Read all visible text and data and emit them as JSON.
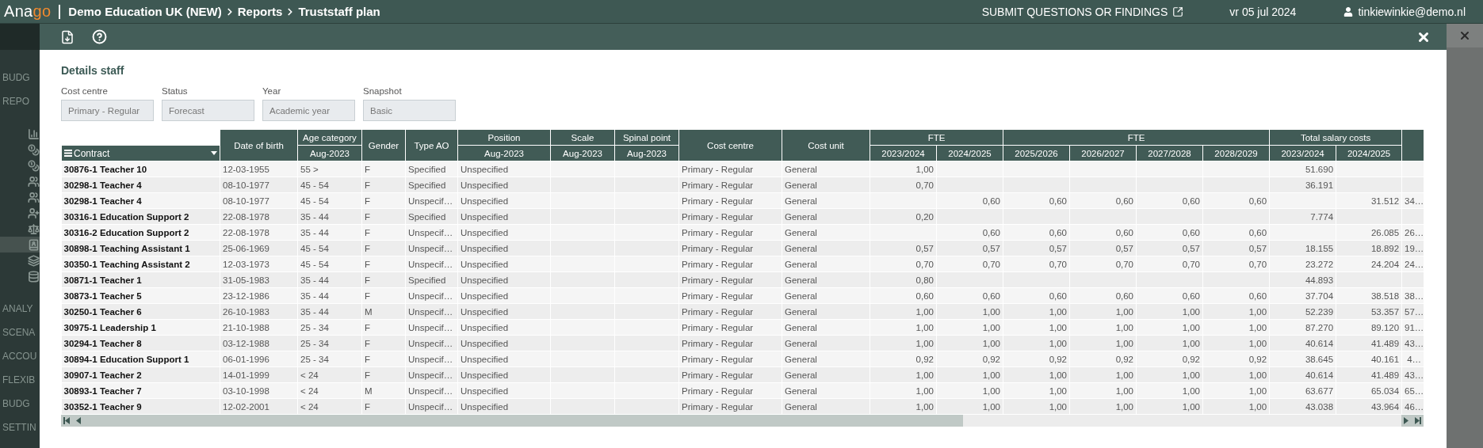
{
  "top_bar": {
    "logo": {
      "text": "Ana",
      "accent": "go"
    },
    "breadcrumb": [
      "Demo Education UK (NEW)",
      "Reports",
      "Truststaff plan"
    ],
    "feedback_link": "SUBMIT QUESTIONS OR FINDINGS",
    "date": "vr 05 jul 2024",
    "user": "tinkiewinkie@demo.nl"
  },
  "sidebar": {
    "items": [
      {
        "kind": "text",
        "label": "BUDG"
      },
      {
        "kind": "text",
        "label": "REPO"
      },
      {
        "kind": "icon",
        "selected": false
      },
      {
        "kind": "icon",
        "selected": false
      },
      {
        "kind": "icon",
        "selected": false
      },
      {
        "kind": "icon",
        "selected": false
      },
      {
        "kind": "icon",
        "selected": false
      },
      {
        "kind": "icon",
        "selected": false
      },
      {
        "kind": "icon",
        "selected": false
      },
      {
        "kind": "icon",
        "selected": true
      },
      {
        "kind": "icon",
        "selected": false
      },
      {
        "kind": "icon",
        "selected": false
      },
      {
        "kind": "text",
        "label": "ANALY"
      },
      {
        "kind": "text",
        "label": "SCENA"
      },
      {
        "kind": "text",
        "label": "ACCOU"
      },
      {
        "kind": "text",
        "label": "FLEXIB"
      },
      {
        "kind": "text",
        "label": "BUDG"
      },
      {
        "kind": "text",
        "label": "SETTIN"
      }
    ]
  },
  "dialog": {
    "title": "Details staff",
    "filters": [
      {
        "label": "Cost centre",
        "value": "Primary - Regular",
        "disabled": true
      },
      {
        "label": "Status",
        "value": "Forecast",
        "disabled": true
      },
      {
        "label": "Year",
        "value": "Academic year",
        "disabled": true
      },
      {
        "label": "Snapshot",
        "value": "Basic",
        "disabled": true
      }
    ],
    "table": {
      "header": [
        {
          "kind": "menu",
          "label": "Contract"
        },
        {
          "kind": "single",
          "label": "Date of birth"
        },
        {
          "kind": "stacked",
          "label": "Age category",
          "sub": "Aug-2023"
        },
        {
          "kind": "single",
          "label": "Gender"
        },
        {
          "kind": "single",
          "label": "Type AO"
        },
        {
          "kind": "stacked",
          "label": "Position",
          "sub": "Aug-2023"
        },
        {
          "kind": "stacked",
          "label": "Scale",
          "sub": "Aug-2023"
        },
        {
          "kind": "stacked",
          "label": "Spinal point",
          "sub": "Aug-2023"
        },
        {
          "kind": "single",
          "label": "Cost centre"
        },
        {
          "kind": "single",
          "label": "Cost unit"
        },
        {
          "kind": "group",
          "label": "FTE",
          "columns": [
            "2023/2024",
            "2024/2025"
          ]
        },
        {
          "kind": "group",
          "label": "FTE",
          "columns": [
            "2025/2026",
            "2026/2027",
            "2027/2028",
            "2028/2029"
          ]
        },
        {
          "kind": "group",
          "label": "Total salary costs",
          "columns": [
            "2023/2024",
            "2024/2025"
          ]
        },
        {
          "kind": "blank"
        }
      ],
      "rows": [
        [
          "30876-1 Teacher 10",
          "12-03-1955",
          "55 >",
          "F",
          "Specified",
          "Unspecified",
          null,
          null,
          "Primary - Regular",
          "General",
          "1,00",
          null,
          null,
          null,
          null,
          null,
          "51.690",
          null,
          null
        ],
        [
          "30298-1 Teacher 4",
          "08-10-1977",
          "45 - 54",
          "F",
          "Specified",
          "Unspecified",
          null,
          null,
          "Primary - Regular",
          "General",
          "0,70",
          null,
          null,
          null,
          null,
          null,
          "36.191",
          null,
          null
        ],
        [
          "30298-1 Teacher 4",
          "08-10-1977",
          "45 - 54",
          "F",
          "Unspecif…",
          "Unspecified",
          null,
          null,
          "Primary - Regular",
          "General",
          null,
          "0,60",
          "0,60",
          "0,60",
          "0,60",
          "0,60",
          null,
          "31.512",
          "34…"
        ],
        [
          "30316-1 Education Support 2",
          "22-08-1978",
          "35 - 44",
          "F",
          "Specified",
          "Unspecified",
          null,
          null,
          "Primary - Regular",
          "General",
          "0,20",
          null,
          null,
          null,
          null,
          null,
          "7.774",
          null,
          null
        ],
        [
          "30316-2 Education Support 2",
          "22-08-1978",
          "35 - 44",
          "F",
          "Unspecif…",
          "Unspecified",
          null,
          null,
          "Primary - Regular",
          "General",
          null,
          "0,60",
          "0,60",
          "0,60",
          "0,60",
          "0,60",
          null,
          "26.085",
          "26…"
        ],
        [
          "30898-1 Teaching Assistant 1",
          "25-06-1969",
          "45 - 54",
          "F",
          "Unspecif…",
          "Unspecified",
          null,
          null,
          "Primary - Regular",
          "General",
          "0,57",
          "0,57",
          "0,57",
          "0,57",
          "0,57",
          "0,57",
          "18.155",
          "18.892",
          "19…"
        ],
        [
          "30350-1 Teaching Assistant 2",
          "12-03-1973",
          "45 - 54",
          "F",
          "Unspecif…",
          "Unspecified",
          null,
          null,
          "Primary - Regular",
          "General",
          "0,70",
          "0,70",
          "0,70",
          "0,70",
          "0,70",
          "0,70",
          "23.272",
          "24.204",
          "24…"
        ],
        [
          "30871-1 Teacher 1",
          "31-05-1983",
          "35 - 44",
          "F",
          "Specified",
          "Unspecified",
          null,
          null,
          "Primary - Regular",
          "General",
          "0,80",
          null,
          null,
          null,
          null,
          null,
          "44.893",
          null,
          null
        ],
        [
          "30873-1 Teacher 5",
          "23-12-1986",
          "35 - 44",
          "F",
          "Unspecif…",
          "Unspecified",
          null,
          null,
          "Primary - Regular",
          "General",
          "0,60",
          "0,60",
          "0,60",
          "0,60",
          "0,60",
          "0,60",
          "37.704",
          "38.518",
          "38…"
        ],
        [
          "30250-1 Teacher 6",
          "26-10-1983",
          "35 - 44",
          "M",
          "Unspecif…",
          "Unspecified",
          null,
          null,
          "Primary - Regular",
          "General",
          "1,00",
          "1,00",
          "1,00",
          "1,00",
          "1,00",
          "1,00",
          "52.239",
          "53.357",
          "57…"
        ],
        [
          "30975-1 Leadership 1",
          "21-10-1988",
          "25 - 34",
          "F",
          "Unspecif…",
          "Unspecified",
          null,
          null,
          "Primary - Regular",
          "General",
          "1,00",
          "1,00",
          "1,00",
          "1,00",
          "1,00",
          "1,00",
          "87.270",
          "89.120",
          "91…"
        ],
        [
          "30294-1 Teacher 8",
          "03-12-1988",
          "25 - 34",
          "F",
          "Unspecif…",
          "Unspecified",
          null,
          null,
          "Primary - Regular",
          "General",
          "1,00",
          "1,00",
          "1,00",
          "1,00",
          "1,00",
          "1,00",
          "40.614",
          "41.489",
          "43…"
        ],
        [
          "30894-1 Education Support 1",
          "06-01-1996",
          "25 - 34",
          "F",
          "Unspecif…",
          "Unspecified",
          null,
          null,
          "Primary - Regular",
          "General",
          "0,92",
          "0,92",
          "0,92",
          "0,92",
          "0,92",
          "0,92",
          "38.645",
          "40.161",
          "4…"
        ],
        [
          "30907-1 Teacher 2",
          "14-01-1999",
          "< 24",
          "F",
          "Unspecif…",
          "Unspecified",
          null,
          null,
          "Primary - Regular",
          "General",
          "1,00",
          "1,00",
          "1,00",
          "1,00",
          "1,00",
          "1,00",
          "40.614",
          "41.489",
          "43…"
        ],
        [
          "30893-1 Teacher 7",
          "03-10-1998",
          "< 24",
          "M",
          "Unspecif…",
          "Unspecified",
          null,
          null,
          "Primary - Regular",
          "General",
          "1,00",
          "1,00",
          "1,00",
          "1,00",
          "1,00",
          "1,00",
          "63.677",
          "65.034",
          "65…"
        ],
        [
          "30352-1 Teacher 9",
          "12-02-2001",
          "< 24",
          "F",
          "Unspecif…",
          "Unspecified",
          null,
          null,
          "Primary - Regular",
          "General",
          "1,00",
          "1,00",
          "1,00",
          "1,00",
          "1,00",
          "1,00",
          "43.038",
          "43.964",
          "46…"
        ]
      ]
    }
  }
}
